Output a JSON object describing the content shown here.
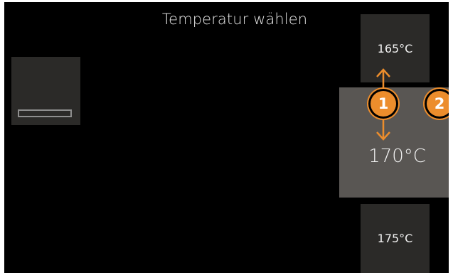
{
  "screen": {
    "title": "Temperatur wählen"
  },
  "function_tile": {
    "icon": "tray-icon"
  },
  "temperature_scroller": {
    "previous": "165°C",
    "current": "170°C",
    "next": "175°C"
  },
  "callouts": [
    {
      "label": "1"
    },
    {
      "label": "2"
    }
  ],
  "colors": {
    "background": "#000000",
    "tile": "#2b2a28",
    "selected_tile": "#595653",
    "accent": "#ec8d2c",
    "text": "#f2f2f2"
  }
}
